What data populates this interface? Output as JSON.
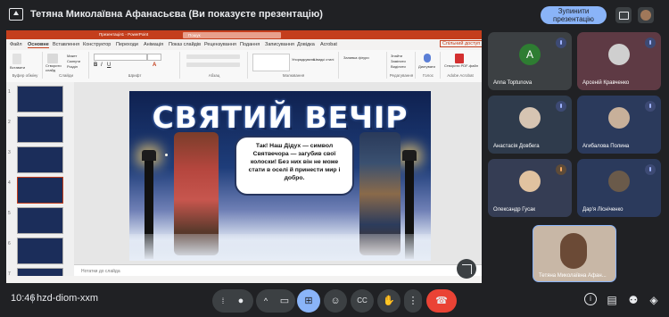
{
  "meeting": {
    "banner_text": "Тетяна Миколаївна Афанасьєва (Ви показуєте презентацію)",
    "stop_button": "Зупинити презентацію",
    "time": "10:46",
    "code": "hzd-diom-xxm"
  },
  "powerpoint": {
    "title_bar_text": "Презентація1 - PowerPoint",
    "search_placeholder": "Пошук",
    "tabs": [
      "Файл",
      "Основне",
      "Вставлення",
      "Конструктор",
      "Переходи",
      "Анімація",
      "Показ слайдів",
      "Рецензування",
      "Подання",
      "Записування",
      "Довідка",
      "Acrobat"
    ],
    "share_label": "Спільний доступ",
    "ribbon_groups": [
      "Буфер обміну",
      "Слайди",
      "Шрифт",
      "Абзац",
      "Малювання",
      "Редагування",
      "Голос",
      "Adobe Acrobat"
    ],
    "ribbon_buttons": {
      "paste": "Вставити",
      "new_slide": "Створити слайд",
      "layout": "Макет",
      "reset": "Скинути",
      "section": "Розділ",
      "arrange": "Упорядкувати",
      "quick_styles": "Швидкі стилі",
      "shape_fill": "Заливка фігури",
      "find": "Знайти",
      "replace": "Замінити",
      "select": "Виділити",
      "dictate": "Диктувати",
      "create_pdf": "Створити PDF-файл"
    },
    "slide_numbers": [
      "1",
      "2",
      "3",
      "4",
      "5",
      "6",
      "7",
      "8"
    ],
    "notes_placeholder": "Нотатки до слайда",
    "slide": {
      "title": "СВЯТИЙ ВЕЧІР",
      "bubble_text": "Так! Наш Дідух — символ Святвечора — загубив свої колоски! Без них він не може стати в оселі й принести мир і добро."
    }
  },
  "participants": [
    {
      "name": "Anna Toptunova",
      "avatar_letter": "A",
      "avatar_color": "#2e7d32",
      "mic": "muted"
    },
    {
      "name": "Арсеній Кравченко",
      "mic": "muted"
    },
    {
      "name": "Анастасія Довбега",
      "mic": "muted"
    },
    {
      "name": "Агибалова Полина",
      "mic": "muted"
    },
    {
      "name": "Олександр Гусак",
      "mic": "muted"
    },
    {
      "name": "Дар'я Лісніченко",
      "mic": "muted"
    }
  ],
  "self_view": {
    "name": "Тетяна Миколаївна Афан..."
  },
  "controls": {
    "icons": [
      "hand-raise-icon",
      "mic-icon",
      "chevron-up-icon",
      "camera-icon",
      "present-icon",
      "emoji-icon",
      "captions-icon",
      "raise-hand-icon",
      "more-icon",
      "end-call-icon"
    ],
    "right_icons": [
      "info-icon",
      "chat-icon",
      "people-icon",
      "activities-icon"
    ]
  },
  "colors": {
    "accent": "#8ab4f8",
    "end_call": "#ea4335",
    "present_active": "#8ab4f8",
    "powerpoint_brand": "#c43e1c"
  }
}
